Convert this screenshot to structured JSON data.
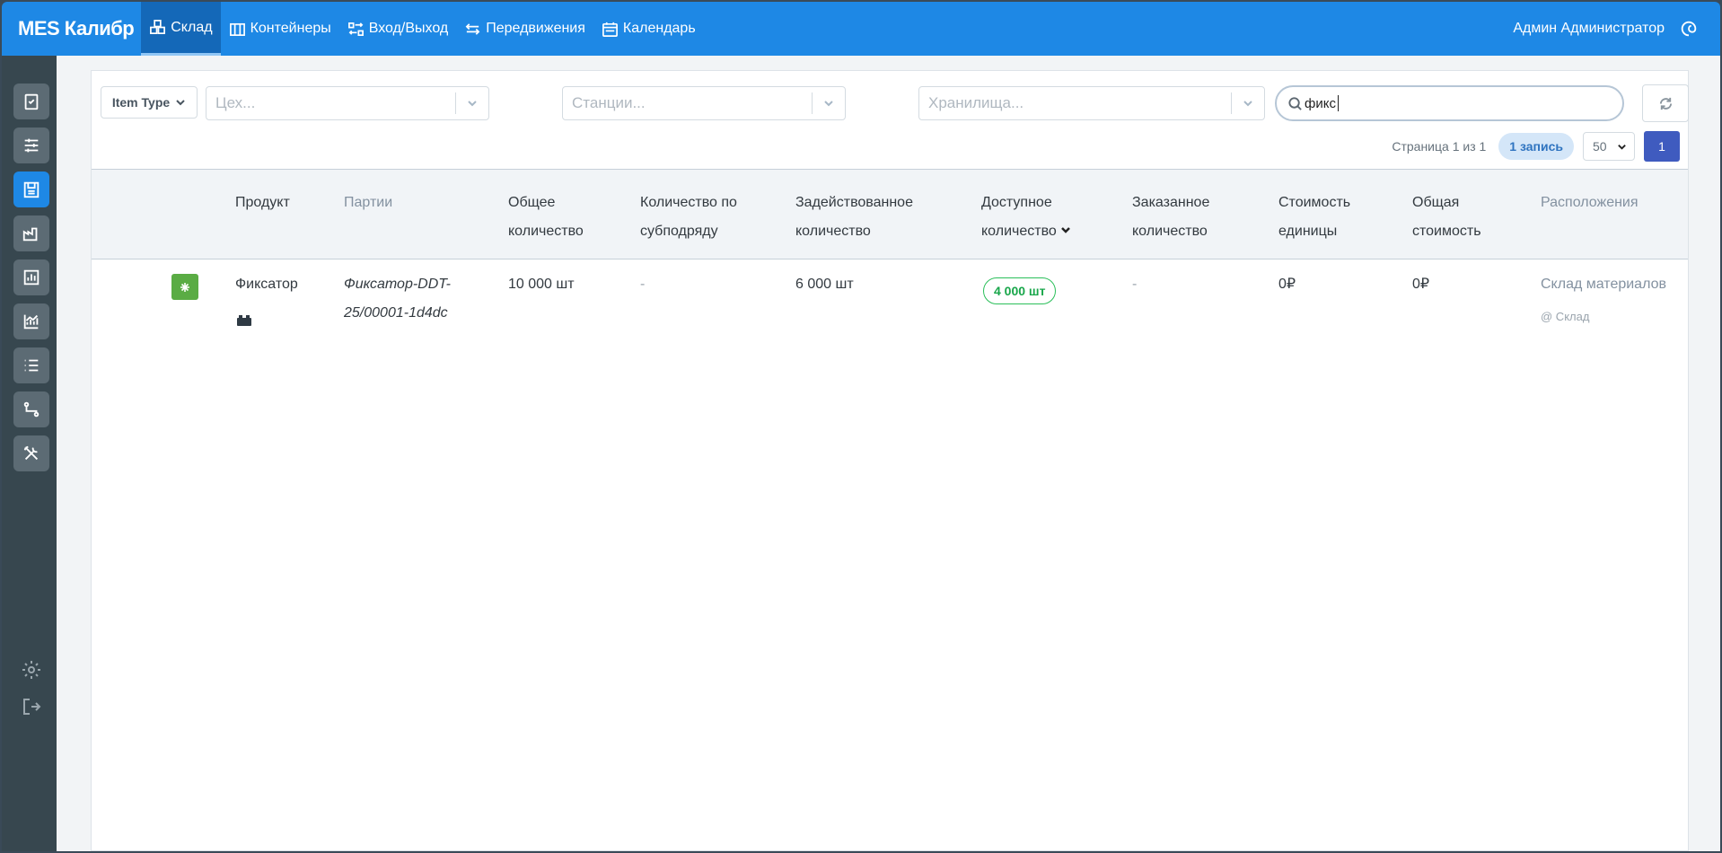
{
  "topbar": {
    "brand": "MES Калибр",
    "nav": [
      {
        "label": "Склад",
        "icon": "warehouse-icon",
        "active": true
      },
      {
        "label": "Контейнеры",
        "icon": "containers-icon"
      },
      {
        "label": "Вход/Выход",
        "icon": "inout-icon"
      },
      {
        "label": "Передвижения",
        "icon": "transfer-icon"
      },
      {
        "label": "Календарь",
        "icon": "calendar-icon"
      }
    ],
    "user": "Админ Администратор"
  },
  "sidebar": {
    "items": [
      "tasks-icon",
      "sliders-icon",
      "warehouse-icon",
      "factory-icon",
      "bar-chart-icon",
      "line-chart-icon",
      "list-icon",
      "route-icon",
      "tools-icon"
    ],
    "active_index": 2,
    "bottom": [
      "settings-icon",
      "logout-icon"
    ]
  },
  "filters": {
    "item_type_label": "Item Type",
    "workshop_placeholder": "Цех...",
    "stations_placeholder": "Станции...",
    "storage_placeholder": "Хранилища...",
    "search_value": "фикс"
  },
  "pager": {
    "page_info": "Страница 1 из 1",
    "records": "1 запись",
    "per_page": "50",
    "current_page": "1"
  },
  "table": {
    "columns": {
      "product": "Продукт",
      "batches": "Партии",
      "total_qty_1": "Общее",
      "total_qty_2": "количество",
      "subcontract_1": "Количество по",
      "subcontract_2": "субподряду",
      "committed_1": "Задействованное",
      "committed_2": "количество",
      "available_1": "Доступное",
      "available_2": "количество",
      "ordered_1": "Заказанное",
      "ordered_2": "количество",
      "unit_cost_1": "Стоимость",
      "unit_cost_2": "единицы",
      "total_cost_1": "Общая",
      "total_cost_2": "стоимость",
      "locations": "Расположения"
    },
    "rows": [
      {
        "product": "Фиксатор",
        "batch_1": "Фиксатор-DDT-",
        "batch_2": "25/00001-1d4dc",
        "total_qty": "10 000 шт",
        "subcontract": "-",
        "committed": "6 000 шт",
        "available": "4 000 шт",
        "ordered": "-",
        "unit_cost": "0₽",
        "total_cost": "0₽",
        "location": "Склад материалов",
        "location_sub": "@ Склад"
      }
    ]
  },
  "colors": {
    "topbar": "#1e88e5",
    "sidebar": "#37474f",
    "active_page": "#3f5bbf",
    "available_pill": "#18a64a",
    "product_mark": "#5aac44"
  }
}
